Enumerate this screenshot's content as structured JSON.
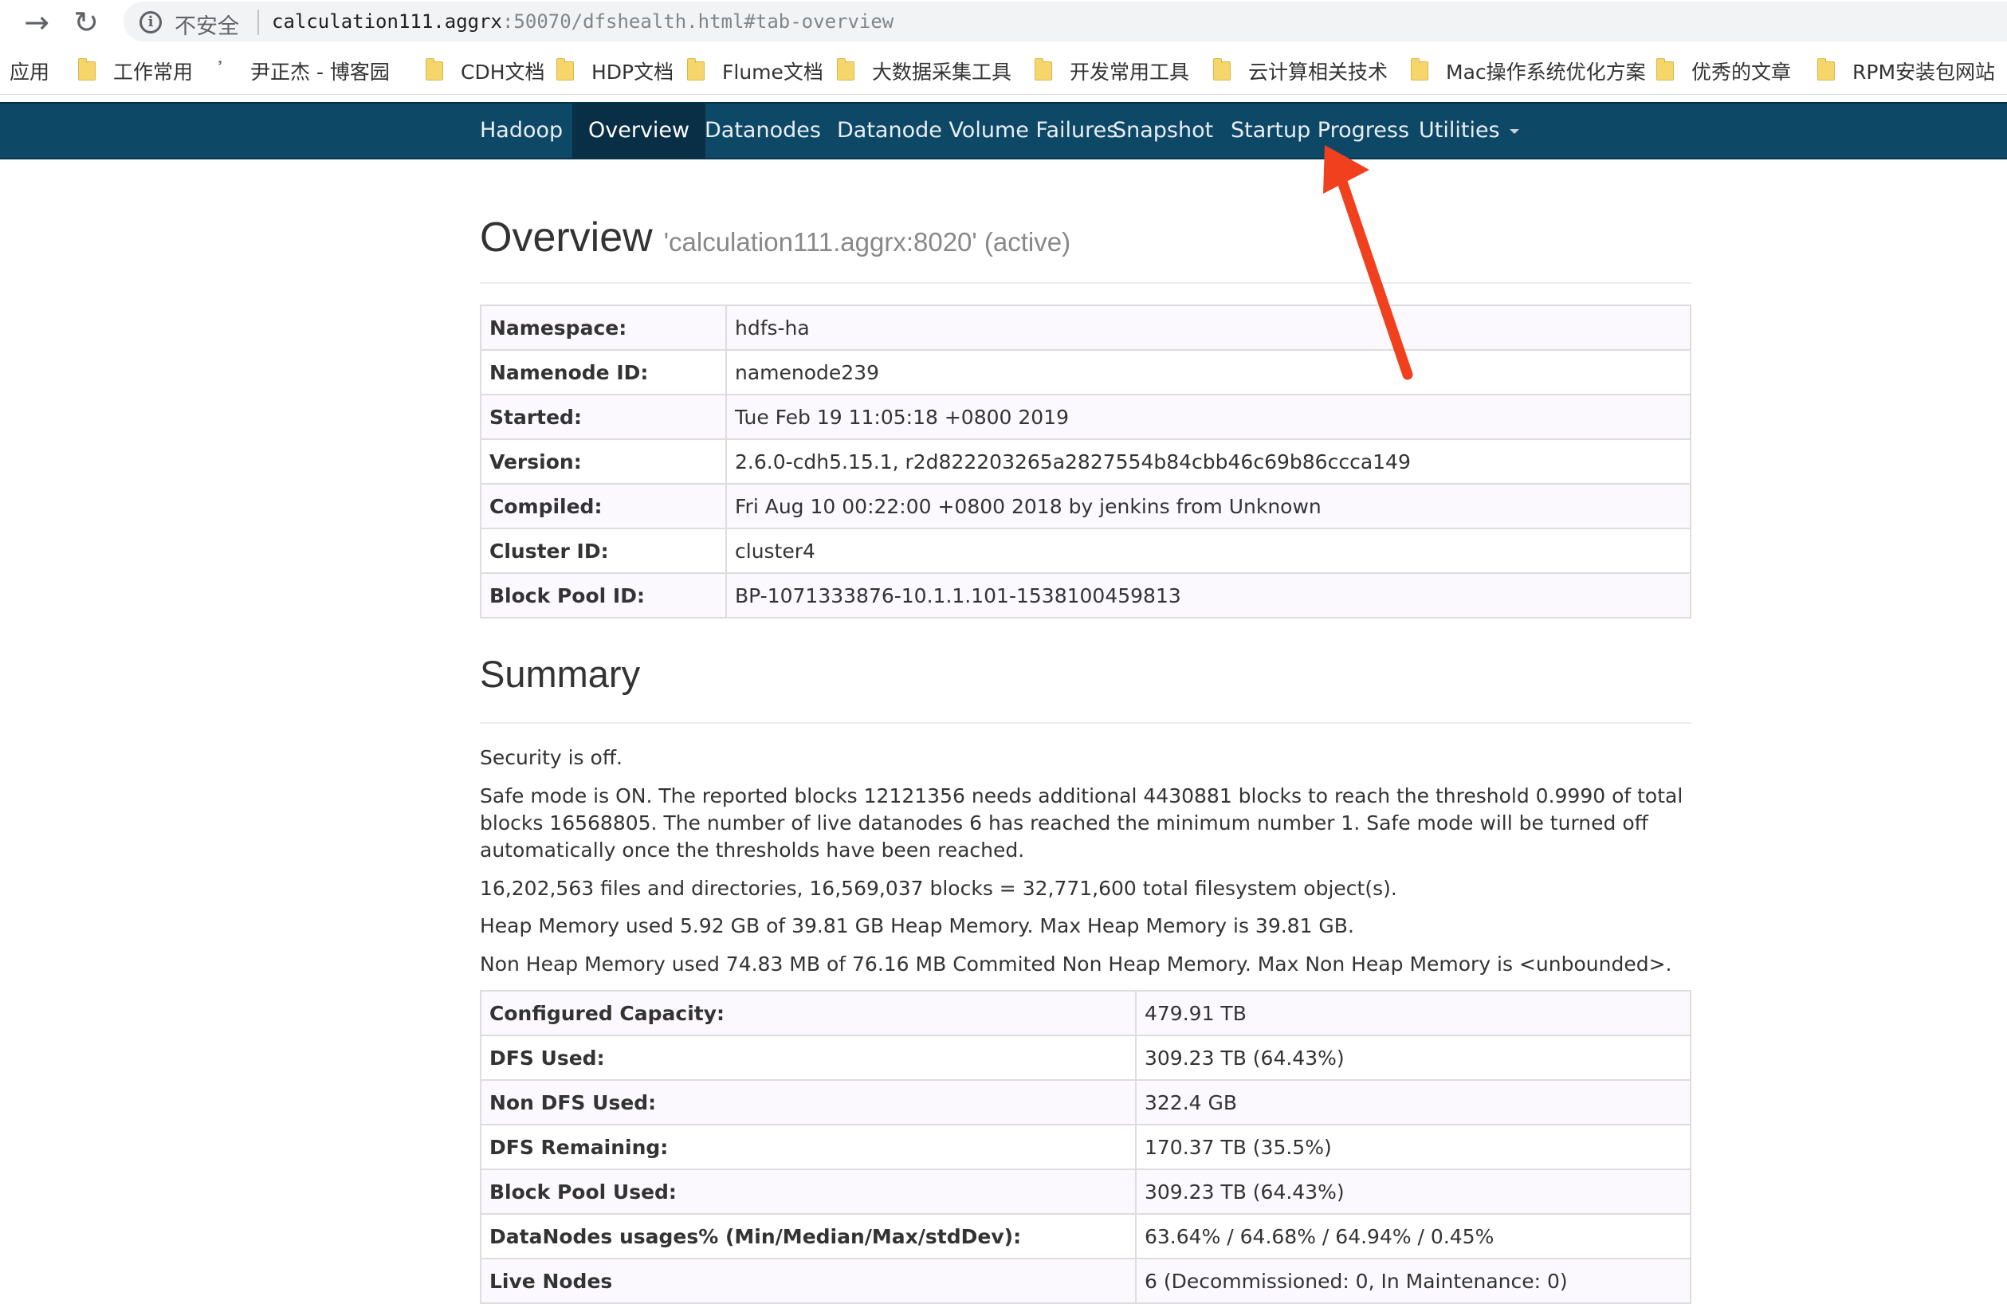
{
  "browser": {
    "url_host": "calculation111.aggrx",
    "url_rest": ":50070/dfshealth.html#tab-overview",
    "insecure_label": "不安全",
    "icons": [
      "back-arrow-icon",
      "reload-icon",
      "info-icon"
    ]
  },
  "bookmarks": [
    {
      "label": "应用",
      "icon": "apps"
    },
    {
      "label": "工作常用",
      "icon": "folder"
    },
    {
      "label": "尹正杰 - 博客园",
      "icon": "blog"
    },
    {
      "label": "CDH文档",
      "icon": "folder"
    },
    {
      "label": "HDP文档",
      "icon": "folder"
    },
    {
      "label": "Flume文档",
      "icon": "folder"
    },
    {
      "label": "大数据采集工具",
      "icon": "folder"
    },
    {
      "label": "开发常用工具",
      "icon": "folder"
    },
    {
      "label": "云计算相关技术",
      "icon": "folder"
    },
    {
      "label": "Mac操作系统优化方案",
      "icon": "folder"
    },
    {
      "label": "优秀的文章",
      "icon": "folder"
    },
    {
      "label": "RPM安装包网站",
      "icon": "folder"
    }
  ],
  "navbar": {
    "brand": "Hadoop",
    "items": [
      "Overview",
      "Datanodes",
      "Datanode Volume Failures",
      "Snapshot",
      "Startup Progress",
      "Utilities"
    ],
    "active": "Overview",
    "bg_color": "#0e4867"
  },
  "overview": {
    "title": "Overview",
    "subtitle": "'calculation111.aggrx:8020' (active)",
    "rows": [
      {
        "label": "Namespace:",
        "value": "hdfs-ha"
      },
      {
        "label": "Namenode ID:",
        "value": "namenode239"
      },
      {
        "label": "Started:",
        "value": "Tue Feb 19 11:05:18 +0800 2019"
      },
      {
        "label": "Version:",
        "value": "2.6.0-cdh5.15.1, r2d822203265a2827554b84cbb46c69b86ccca149"
      },
      {
        "label": "Compiled:",
        "value": "Fri Aug 10 00:22:00 +0800 2018 by jenkins from Unknown"
      },
      {
        "label": "Cluster ID:",
        "value": "cluster4"
      },
      {
        "label": "Block Pool ID:",
        "value": "BP-1071333876-10.1.1.101-1538100459813"
      }
    ]
  },
  "summary": {
    "title": "Summary",
    "security": "Security is off.",
    "safemode": "Safe mode is ON. The reported blocks 12121356 needs additional 4430881 blocks to reach the threshold 0.9990 of total blocks 16568805. The number of live datanodes 6 has reached the minimum number 1. Safe mode will be turned off automatically once the thresholds have been reached.",
    "objects": "16,202,563 files and directories, 16,569,037 blocks = 32,771,600 total filesystem object(s).",
    "heap": "Heap Memory used 5.92 GB of 39.81 GB Heap Memory. Max Heap Memory is 39.81 GB.",
    "nonheap": "Non Heap Memory used 74.83 MB of 76.16 MB Commited Non Heap Memory. Max Non Heap Memory is <unbounded>.",
    "rows": [
      {
        "label": "Configured Capacity:",
        "value": "479.91 TB"
      },
      {
        "label": "DFS Used:",
        "value": "309.23 TB (64.43%)"
      },
      {
        "label": "Non DFS Used:",
        "value": "322.4 GB"
      },
      {
        "label": "DFS Remaining:",
        "value": "170.37 TB (35.5%)"
      },
      {
        "label": "Block Pool Used:",
        "value": "309.23 TB (64.43%)"
      },
      {
        "label": "DataNodes usages% (Min/Median/Max/stdDev):",
        "value": "63.64% / 64.68% / 64.94% / 0.45%"
      },
      {
        "label": "Live Nodes",
        "value": "6 (Decommissioned: 0, In Maintenance: 0)"
      }
    ]
  },
  "annotation": {
    "color": "#f0401e",
    "points_to": "Startup Progress"
  }
}
